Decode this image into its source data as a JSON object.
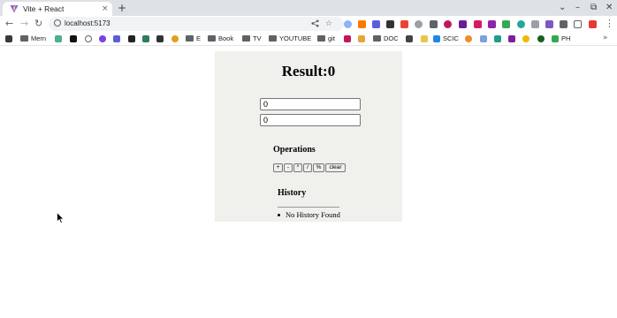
{
  "browser": {
    "tab_title": "Vite + React",
    "tab_close": "×",
    "new_tab": "+",
    "window_controls": {
      "list": "⌄",
      "minimize": "–",
      "restore": "⧉",
      "close": "✕"
    },
    "url": "localhost:5173",
    "nav": {
      "back": "←",
      "forward": "→",
      "reload": "↻"
    },
    "omnibox_icons": {
      "share": "share-icon",
      "star": "☆"
    },
    "menu": "⋮"
  },
  "bookmarks": {
    "items": [
      {
        "label": "",
        "icon": "app-icon",
        "color": "#3a3a3a"
      },
      {
        "label": "Mern",
        "icon": "folder-icon"
      },
      {
        "label": "",
        "icon": "app-icon",
        "color": "#4caf8f"
      },
      {
        "label": "",
        "icon": "app-icon",
        "color": "#111111"
      },
      {
        "label": "",
        "icon": "google-icon",
        "color": "#5f6368"
      },
      {
        "label": "",
        "icon": "app-icon",
        "color": "#7b3fe4"
      },
      {
        "label": "",
        "icon": "app-icon",
        "color": "#5b5fd6"
      },
      {
        "label": "",
        "icon": "app-icon",
        "color": "#222222"
      },
      {
        "label": "",
        "icon": "app-icon",
        "color": "#2e7d5b"
      },
      {
        "label": "",
        "icon": "app-icon",
        "color": "#333333"
      },
      {
        "label": "",
        "icon": "app-icon",
        "color": "#e0a020"
      },
      {
        "label": "E",
        "icon": "folder-icon"
      },
      {
        "label": "Book",
        "icon": "folder-icon"
      },
      {
        "label": "TV",
        "icon": "folder-icon"
      },
      {
        "label": "YOUTUBE",
        "icon": "folder-icon"
      },
      {
        "label": "git",
        "icon": "folder-icon"
      },
      {
        "label": "",
        "icon": "app-icon",
        "color": "#c2185b"
      },
      {
        "label": "",
        "icon": "app-icon",
        "color": "#e8a33a"
      },
      {
        "label": "DOC",
        "icon": "folder-icon"
      },
      {
        "label": "",
        "icon": "app-icon",
        "color": "#444444"
      },
      {
        "label": "",
        "icon": "app-icon",
        "color": "#e7c64a"
      },
      {
        "label": "SCIC",
        "icon": "drive-icon",
        "color": "#1e88e5"
      },
      {
        "label": "",
        "icon": "app-icon",
        "color": "#f08c28"
      },
      {
        "label": "",
        "icon": "app-icon",
        "color": "#7aa2d8"
      },
      {
        "label": "",
        "icon": "app-icon",
        "color": "#1f9e8a"
      },
      {
        "label": "",
        "icon": "app-icon",
        "color": "#7b1fa2"
      },
      {
        "label": "",
        "icon": "app-icon",
        "color": "#f2b705"
      },
      {
        "label": "",
        "icon": "app-icon",
        "color": "#1b5e20"
      },
      {
        "label": "PH",
        "icon": "drive-icon",
        "color": "#34a853"
      }
    ],
    "overflow": "»"
  },
  "app": {
    "result_label": "Result:0",
    "input1_value": "0",
    "input2_value": "0",
    "operations_title": "Operations",
    "operations": [
      "+",
      "-",
      "*",
      "/",
      "%",
      "clear"
    ],
    "history_title": "History",
    "history_empty": "No History Found"
  },
  "colors": {
    "app_background": "#f0f0ed",
    "tab_strip": "#dee1e6"
  }
}
